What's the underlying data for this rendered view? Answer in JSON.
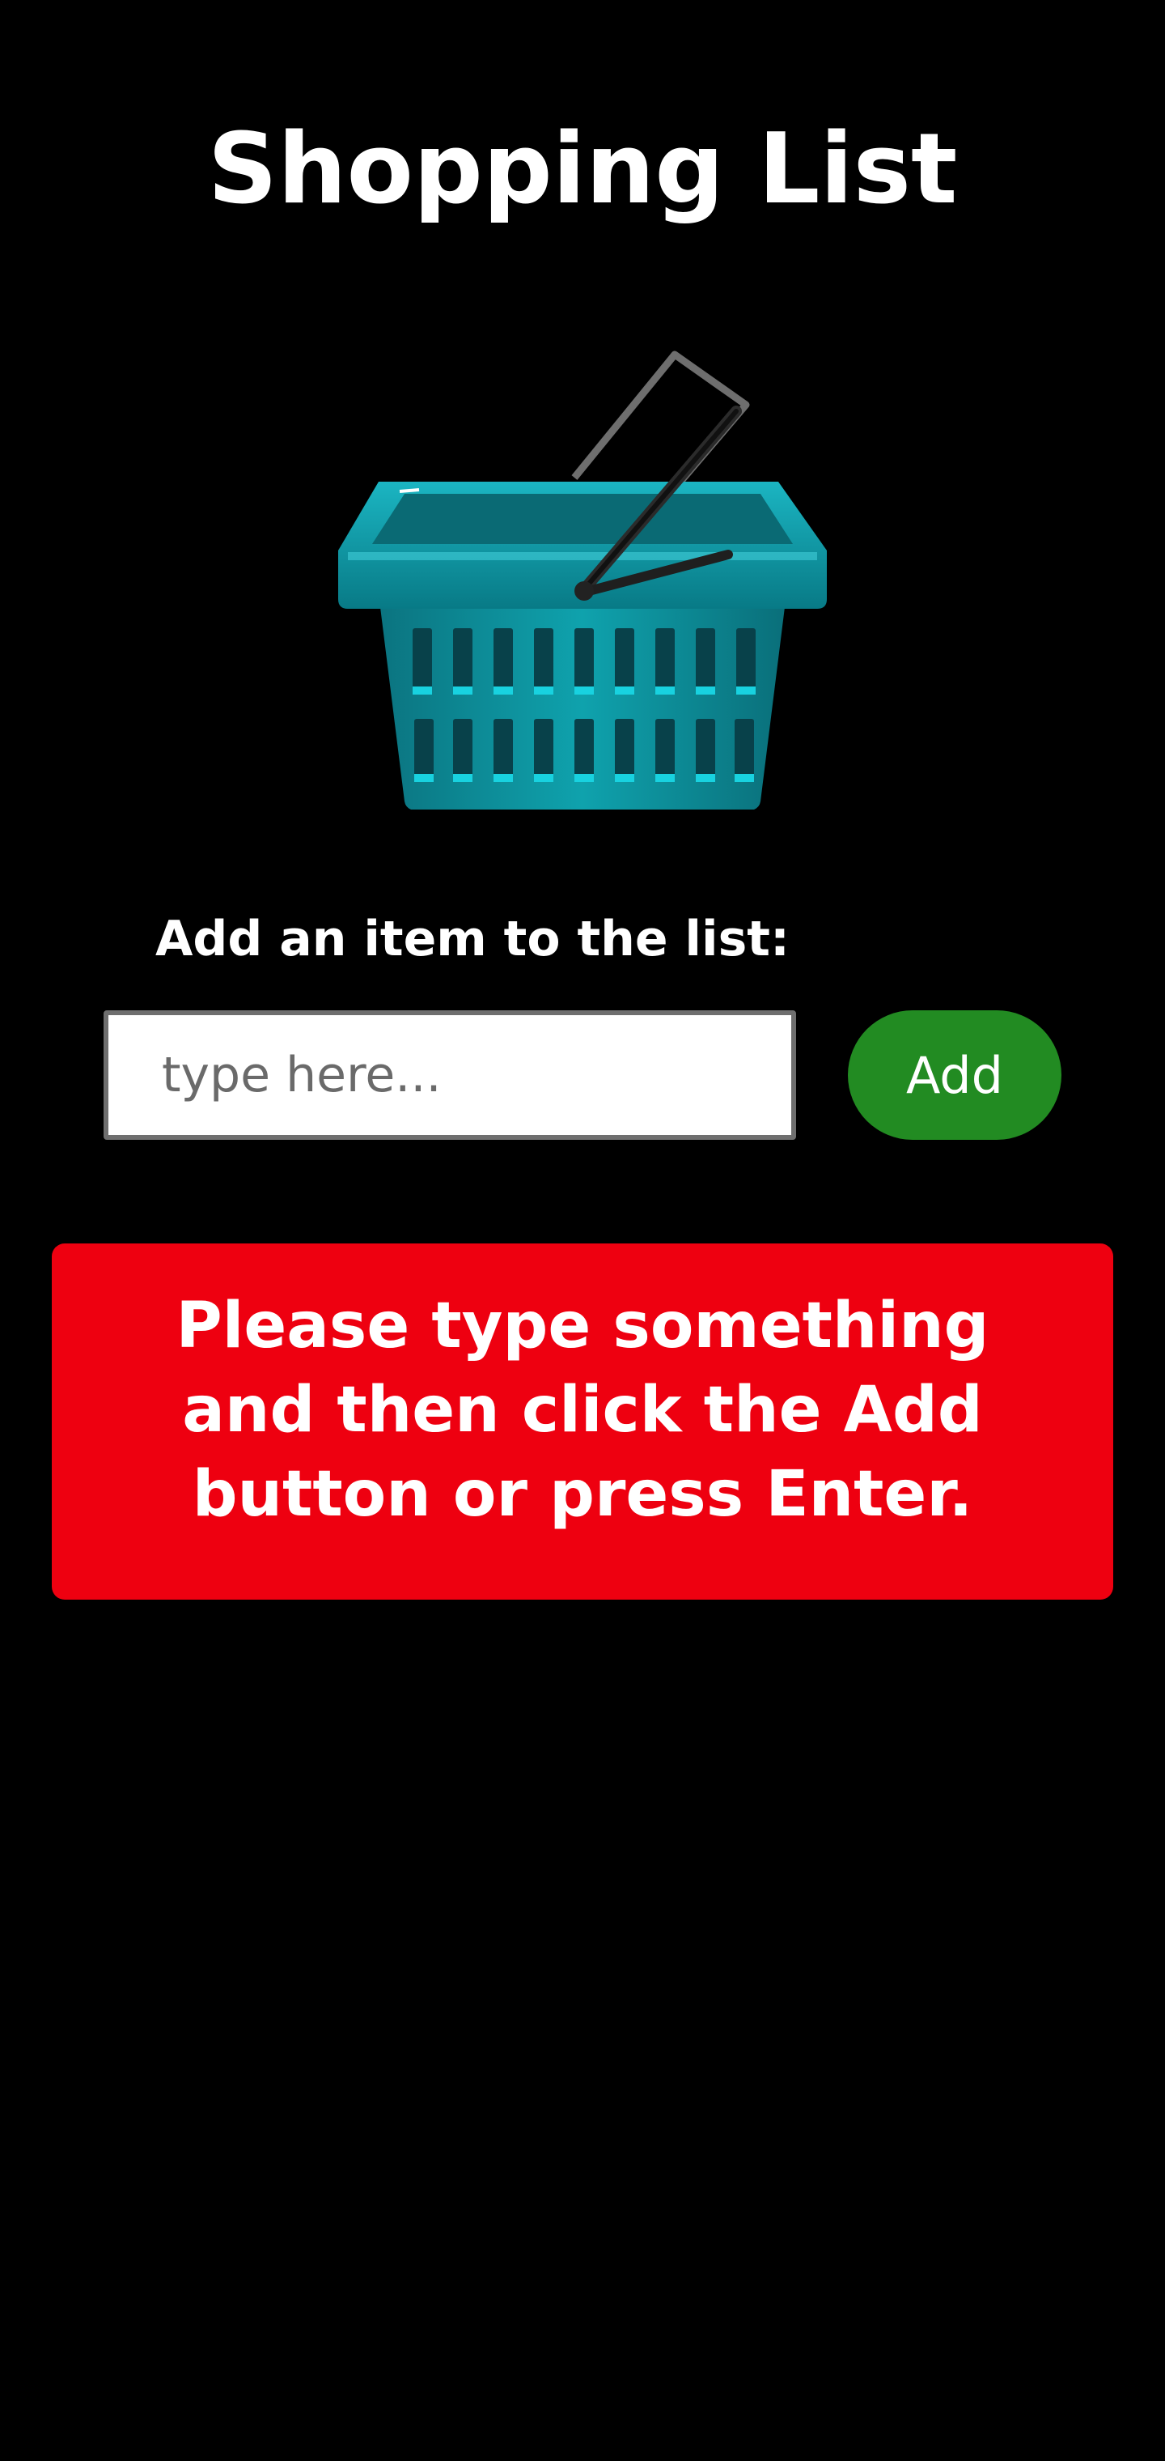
{
  "header": {
    "title": "Shopping List"
  },
  "basket": {
    "icon": "shopping-basket-icon"
  },
  "form": {
    "label": "Add an item to the list:",
    "input_value": "",
    "input_placeholder": "type here...",
    "add_label": "Add"
  },
  "alert": {
    "message": "Please type something and then click the Add button or press Enter."
  },
  "colors": {
    "background": "#000000",
    "add_button": "#228b22",
    "alert": "#ee0010",
    "basket": "#0a8f9c"
  }
}
